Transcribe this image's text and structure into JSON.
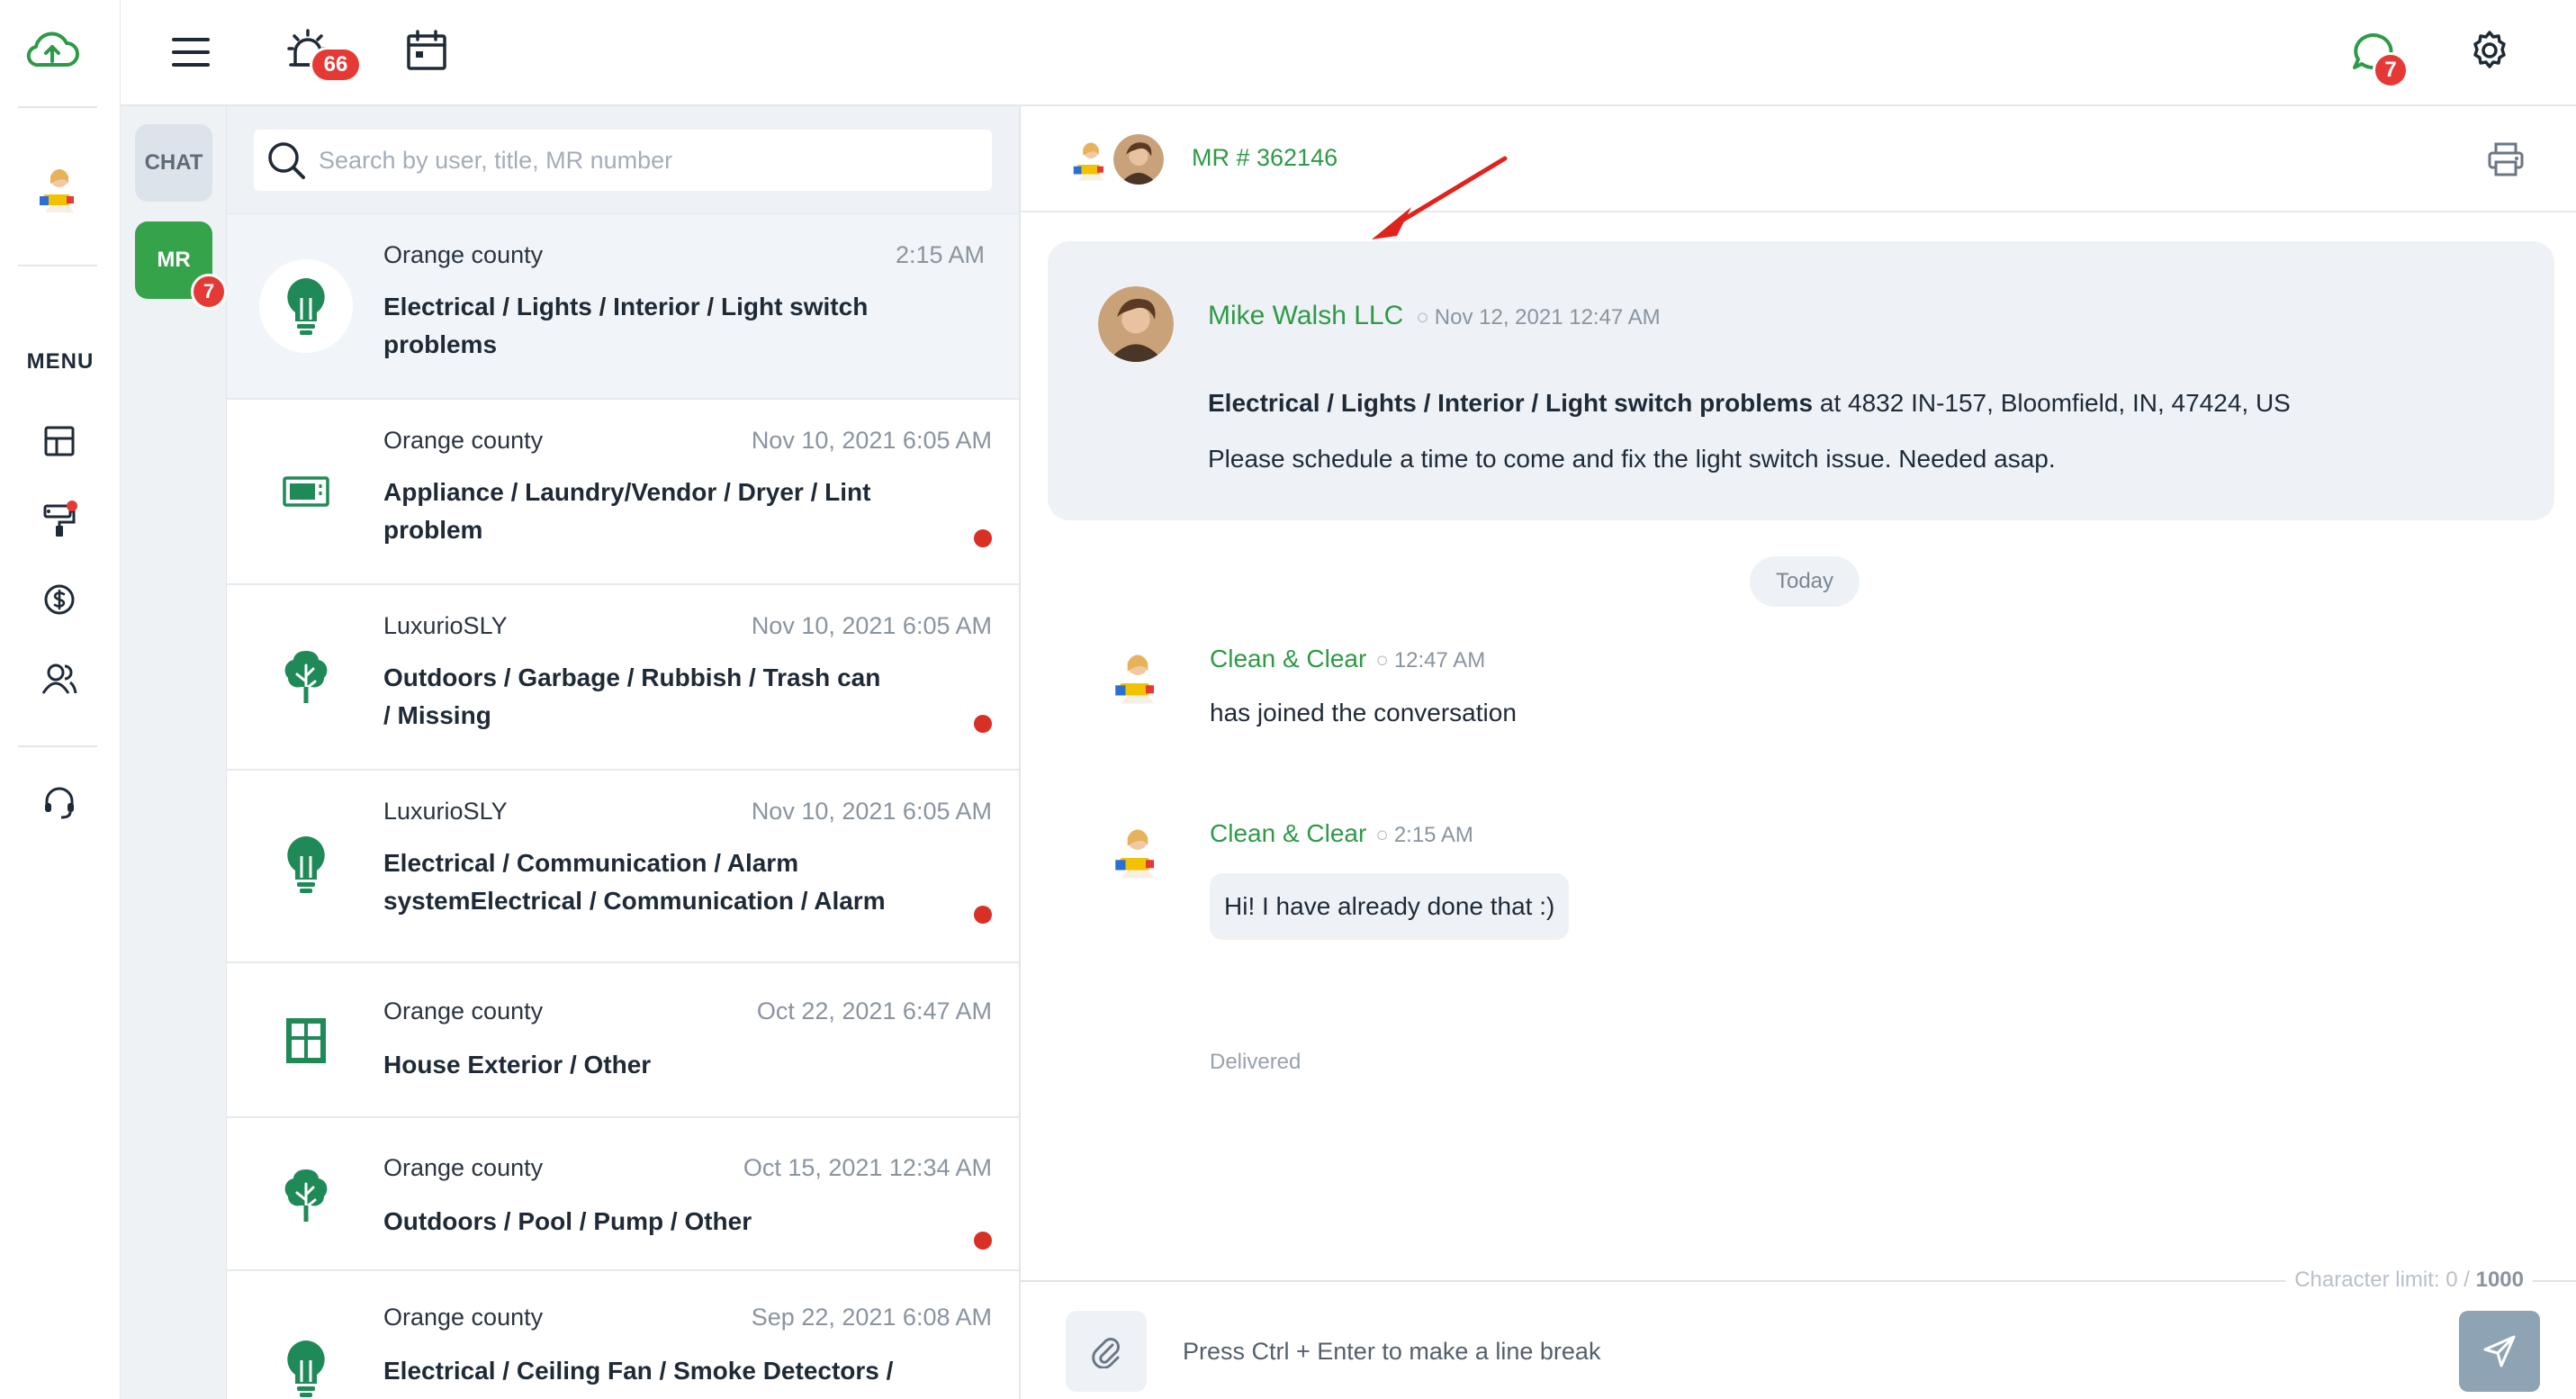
{
  "rail": {
    "menu_label": "MENU"
  },
  "topbar": {
    "alarm_badge": "66",
    "chat_badge": "7"
  },
  "tabs": {
    "chat_label": "CHAT",
    "mr_label": "MR",
    "mr_badge": "7"
  },
  "search": {
    "placeholder": "Search by user, title, MR number"
  },
  "requests": [
    {
      "location": "Orange county",
      "time": "2:15 AM",
      "title": "Electrical / Lights / Interior / Light switch problems",
      "icon": "lightbulb-icon",
      "unread": false,
      "selected": true
    },
    {
      "location": "Orange county",
      "time": "Nov 10, 2021 6:05 AM",
      "title": "Appliance / Laundry/Vendor / Dryer / Lint problem",
      "icon": "appliance-icon",
      "unread": true,
      "selected": false
    },
    {
      "location": "LuxurioSLY",
      "time": "Nov 10, 2021 6:05 AM",
      "title": "Outdoors / Garbage / Rubbish / Trash can / Missing",
      "icon": "tree-icon",
      "unread": true,
      "selected": false
    },
    {
      "location": "LuxurioSLY",
      "time": "Nov 10, 2021 6:05 AM",
      "title": "Electrical / Communication / Alarm systemElectrical / Communication / Alarm",
      "icon": "lightbulb-icon",
      "unread": true,
      "selected": false
    },
    {
      "location": "Orange county",
      "time": "Oct 22, 2021 6:47 AM",
      "title": "House Exterior / Other",
      "icon": "window-icon",
      "unread": false,
      "selected": false
    },
    {
      "location": "Orange county",
      "time": "Oct 15, 2021 12:34 AM",
      "title": "Outdoors / Pool / Pump / Other",
      "icon": "tree-icon",
      "unread": true,
      "selected": false
    },
    {
      "location": "Orange county",
      "time": "Sep 22, 2021 6:08 AM",
      "title": "Electrical / Ceiling Fan / Smoke Detectors /",
      "icon": "lightbulb-icon",
      "unread": false,
      "selected": false
    }
  ],
  "conversation": {
    "mr_number": "MR # 362146",
    "request_card": {
      "sender": "Mike Walsh LLC",
      "time": "Nov 12, 2021 12:47 AM",
      "title": "Electrical / Lights / Interior / Light switch problems",
      "address": " at 4832 IN-157, Bloomfield, IN, 47424, US",
      "message": "Please schedule a time to come and fix the light switch issue. Needed asap."
    },
    "date_divider": "Today",
    "messages": [
      {
        "sender": "Clean & Clear",
        "time": "12:47 AM",
        "text": "has joined the conversation"
      },
      {
        "sender": "Clean & Clear",
        "time": "2:15 AM",
        "text": "Hi! I have already done that :)",
        "status": "Delivered"
      }
    ],
    "char_limit_label": "Character limit: 0 / ",
    "char_limit_max": "1000",
    "compose_placeholder": "Press Ctrl + Enter to make a line break"
  },
  "colors": {
    "accent_green": "#2e9a47",
    "badge_red": "#e53935",
    "icon_green": "#1f8a57",
    "send_button": "#8ea4b5"
  }
}
